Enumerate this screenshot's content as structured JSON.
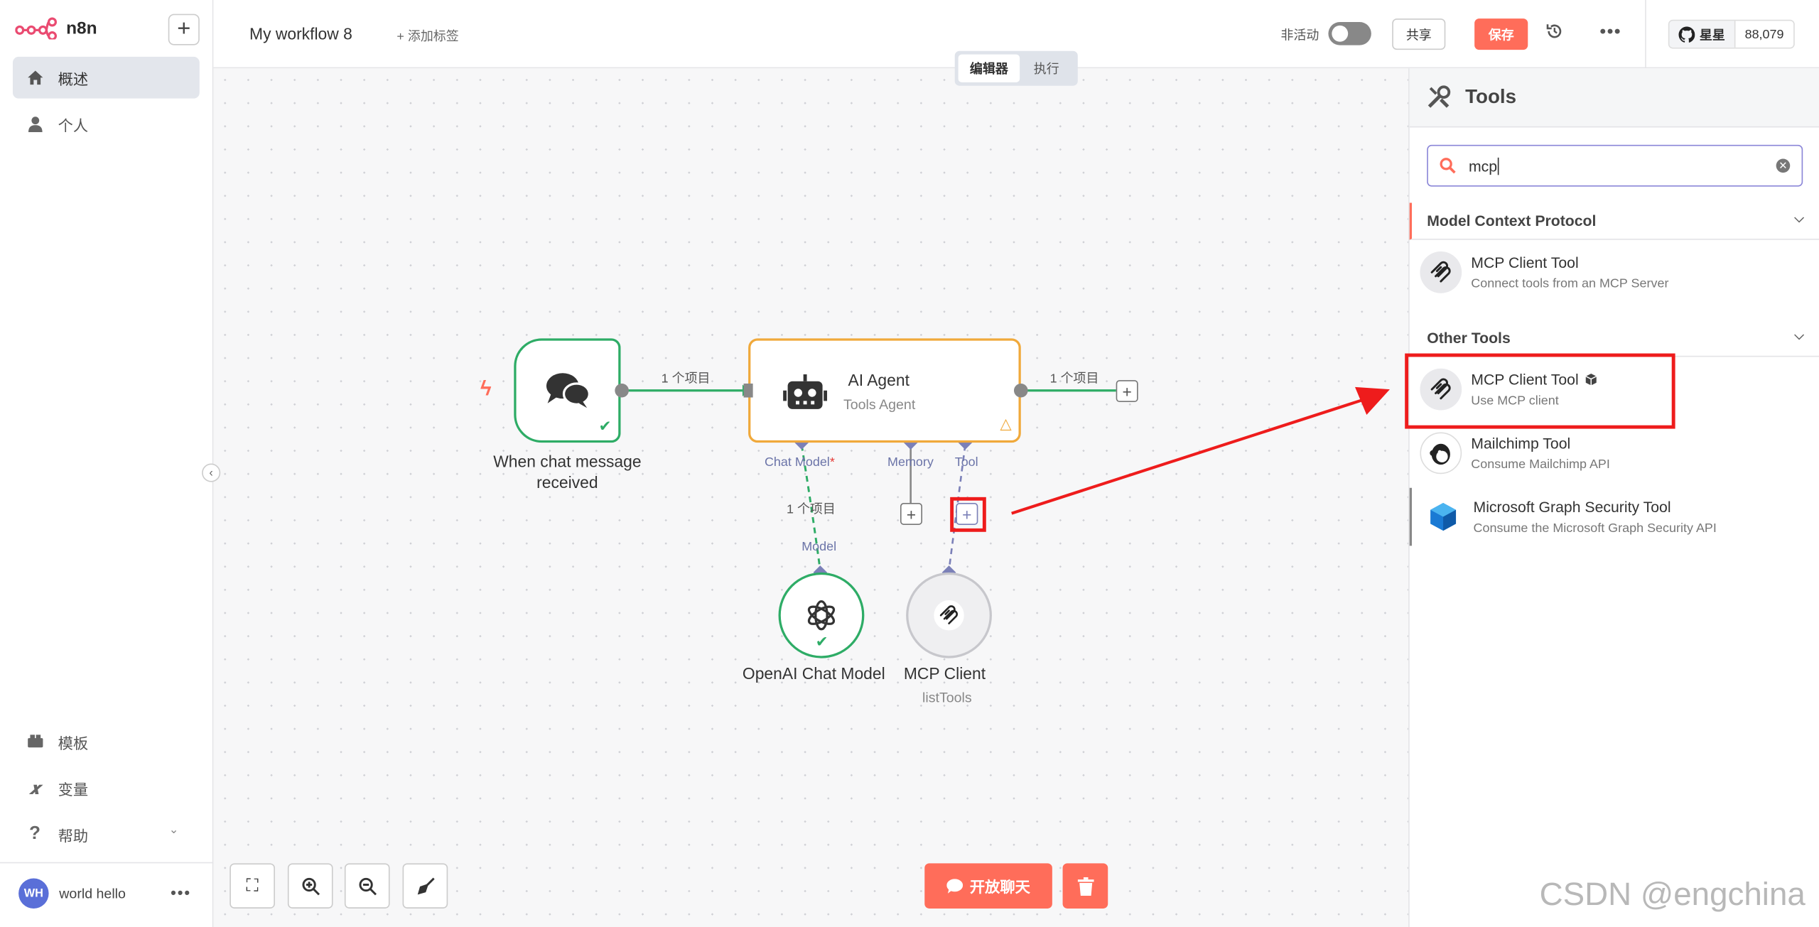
{
  "brand": {
    "name": "n8n",
    "accent": "#ff6d5a"
  },
  "sidebar": {
    "items": [
      {
        "label": "概述",
        "icon": "home-icon"
      },
      {
        "label": "个人",
        "icon": "user-icon"
      }
    ],
    "bottom_items": [
      {
        "label": "模板",
        "icon": "box-icon"
      },
      {
        "label": "变量",
        "icon": "variable-icon"
      },
      {
        "label": "帮助",
        "icon": "help-icon"
      }
    ],
    "user": {
      "initials": "WH",
      "name": "world hello"
    }
  },
  "header": {
    "workflow_name": "My workflow 8",
    "add_tag": "+ 添加标签",
    "inactive_label": "非活动",
    "share": "共享",
    "save": "保存",
    "github_star": "星星",
    "github_count": "88,079"
  },
  "mode_tabs": {
    "editor": "编辑器",
    "executions": "执行"
  },
  "canvas": {
    "trigger": {
      "label_line1": "When chat message",
      "label_line2": "received"
    },
    "agent": {
      "title": "AI Agent",
      "subtitle": "Tools Agent"
    },
    "edges": {
      "trigger_to_agent": "1 个项目",
      "agent_out": "1 个项目",
      "model_edge": "1 个项目"
    },
    "ports": {
      "chat_model": "Chat Model",
      "chat_model_required": "*",
      "memory": "Memory",
      "tool": "Tool",
      "model": "Model"
    },
    "openai": {
      "label": "OpenAI Chat Model"
    },
    "mcp": {
      "label": "MCP Client",
      "sublabel": "listTools"
    },
    "open_chat": "开放聊天"
  },
  "panel": {
    "title": "Tools",
    "search_value": "mcp",
    "categories": [
      {
        "title": "Model Context Protocol",
        "items": [
          {
            "name": "MCP Client Tool",
            "desc": "Connect tools from an MCP Server"
          }
        ]
      },
      {
        "title": "Other Tools",
        "items": [
          {
            "name": "MCP Client Tool",
            "desc": "Use MCP client",
            "badge": "package-icon"
          },
          {
            "name": "Mailchimp Tool",
            "desc": "Consume Mailchimp API"
          },
          {
            "name": "Microsoft Graph Security Tool",
            "desc": "Consume the Microsoft Graph Security API"
          }
        ]
      }
    ]
  },
  "watermark": "CSDN @engchina"
}
